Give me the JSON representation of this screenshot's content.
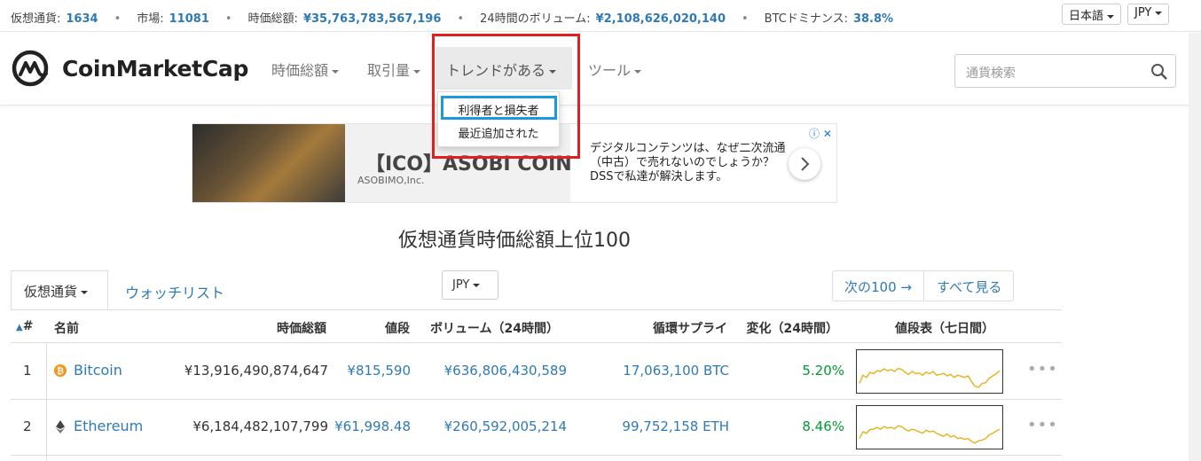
{
  "topbar": {
    "stats": [
      {
        "label": "仮想通貨:",
        "value": "1634"
      },
      {
        "label": "市場:",
        "value": "11081"
      },
      {
        "label": "時価総額:",
        "value": "¥35,763,783,567,196"
      },
      {
        "label": "24時間のボリューム:",
        "value": "¥2,108,626,020,140"
      },
      {
        "label": "BTCドミナンス:",
        "value": "38.8%"
      }
    ],
    "separator": "•",
    "language": "日本語",
    "currency": "JPY"
  },
  "header": {
    "logo_text": "CoinMarketCap",
    "nav": [
      "時価総額",
      "取引量",
      "トレンドがある",
      "ツール"
    ],
    "search_placeholder": "通貨検索"
  },
  "dropdown": {
    "items": [
      "利得者と損失者",
      "最近追加された"
    ]
  },
  "ad": {
    "headline": "【ICO】ASOBI COIN",
    "company": "ASOBIMO,Inc.",
    "body": "デジタルコンテンツは、なぜ二次流通（中古）で売れないのでしょうか？DSSで私達が解決します。",
    "info": "ⓘ ✕"
  },
  "page_title": "仮想通貨時価総額上位100",
  "tabs": {
    "active": "仮想通貨",
    "watchlist": "ウォッチリスト"
  },
  "currency_select": "JPY",
  "pager": {
    "next": "次の100 →",
    "all": "すべて見る"
  },
  "table": {
    "sort_indicator": "▲",
    "headers": [
      "#",
      "名前",
      "時価総額",
      "値段",
      "ボリューム（24時間）",
      "循環サプライ",
      "変化（24時間）",
      "値段表（七日間）"
    ],
    "rows": [
      {
        "rank": "1",
        "name": "Bitcoin",
        "market_cap": "¥13,916,490,874,647",
        "price": "¥815,590",
        "volume": "¥636,806,430,589",
        "supply": "17,063,100 BTC",
        "change": "5.20%",
        "spark": [
          0.82,
          0.6,
          0.66,
          0.52,
          0.56,
          0.48,
          0.5,
          0.43,
          0.48,
          0.45,
          0.5,
          0.42,
          0.44,
          0.52,
          0.58,
          0.5,
          0.56,
          0.54,
          0.6,
          0.52,
          0.56,
          0.5,
          0.6,
          0.58,
          0.55,
          0.62,
          0.58,
          0.66,
          0.6,
          0.63,
          0.66,
          0.62,
          0.78,
          0.9,
          0.92,
          0.82,
          0.8,
          0.68,
          0.62,
          0.56,
          0.48
        ]
      },
      {
        "rank": "2",
        "name": "Ethereum",
        "market_cap": "¥6,184,482,107,799",
        "price": "¥61,998.48",
        "volume": "¥260,592,005,214",
        "supply": "99,752,158 ETH",
        "change": "8.46%",
        "spark": [
          0.8,
          0.62,
          0.66,
          0.56,
          0.55,
          0.5,
          0.55,
          0.48,
          0.52,
          0.5,
          0.54,
          0.46,
          0.48,
          0.55,
          0.6,
          0.55,
          0.58,
          0.62,
          0.66,
          0.58,
          0.62,
          0.6,
          0.66,
          0.7,
          0.74,
          0.68,
          0.76,
          0.72,
          0.8,
          0.78,
          0.82,
          0.8,
          0.88,
          0.92,
          0.86,
          0.84,
          0.8,
          0.7,
          0.66,
          0.6,
          0.55
        ]
      }
    ]
  }
}
